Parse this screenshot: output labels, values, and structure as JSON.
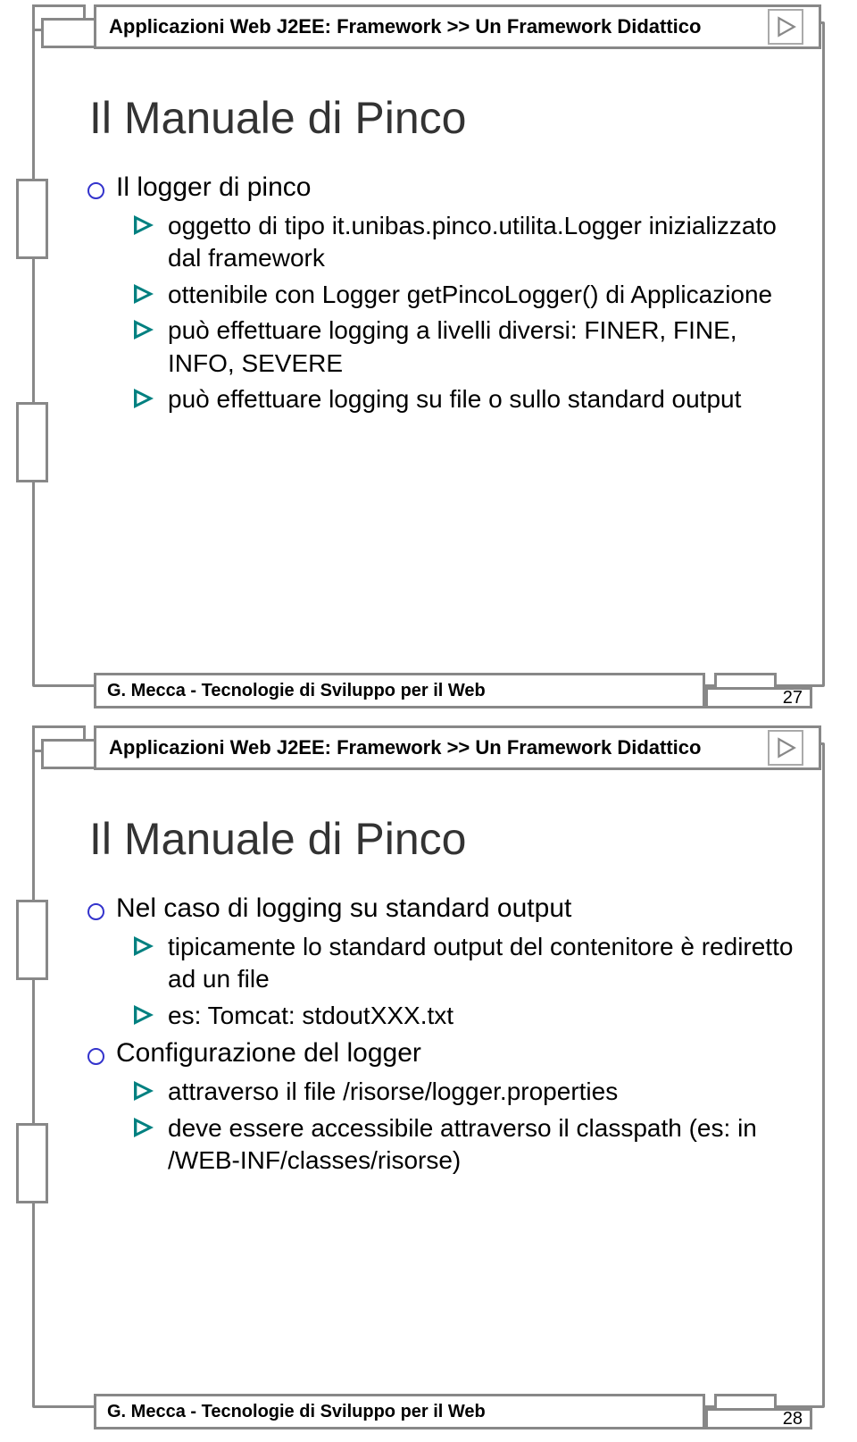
{
  "slide27": {
    "breadcrumb": "Applicazioni Web J2EE: Framework >> Un Framework Didattico",
    "title": "Il Manuale di Pinco",
    "m1": "Il logger di pinco",
    "s1": "oggetto di tipo it.unibas.pinco.utilita.Logger inizializzato dal framework",
    "s2": "ottenibile con Logger getPincoLogger() di Applicazione",
    "s3": "può effettuare logging a livelli diversi: FINER, FINE, INFO, SEVERE",
    "s4": "può effettuare logging su file o sullo standard output",
    "footer": "G. Mecca - Tecnologie di Sviluppo per il Web",
    "page": "27"
  },
  "slide28": {
    "breadcrumb": "Applicazioni Web J2EE: Framework >> Un Framework Didattico",
    "title": "Il Manuale di Pinco",
    "m1": "Nel caso di logging su standard output",
    "s1": "tipicamente lo standard output del contenitore è rediretto ad  un file",
    "s2": "es: Tomcat: stdoutXXX.txt",
    "m2": "Configurazione del logger",
    "s3": "attraverso il file /risorse/logger.properties",
    "s4": "deve essere accessibile attraverso il classpath (es: in /WEB-INF/classes/risorse)",
    "footer": "G. Mecca - Tecnologie di Sviluppo per il Web",
    "page": "28"
  }
}
